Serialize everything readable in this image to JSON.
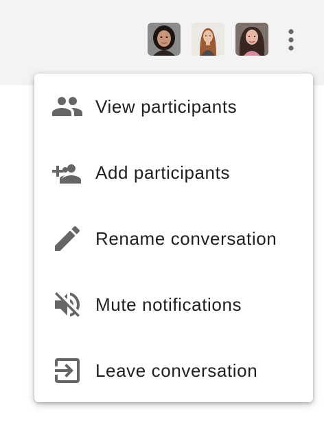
{
  "header": {
    "avatars": [
      {
        "alt": "participant-1"
      },
      {
        "alt": "participant-2"
      },
      {
        "alt": "participant-3"
      }
    ],
    "more_icon": "more-vert-icon"
  },
  "menu": {
    "items": [
      {
        "label": "View participants",
        "icon": "people-icon"
      },
      {
        "label": "Add participants",
        "icon": "add-people-icon"
      },
      {
        "label": "Rename conversation",
        "icon": "pencil-icon"
      },
      {
        "label": "Mute notifications",
        "icon": "volume-off-icon"
      },
      {
        "label": "Leave conversation",
        "icon": "exit-icon"
      }
    ]
  },
  "colors": {
    "icon": "#666666",
    "text": "#1f1f1f",
    "topbar": "#f3f3f3"
  }
}
